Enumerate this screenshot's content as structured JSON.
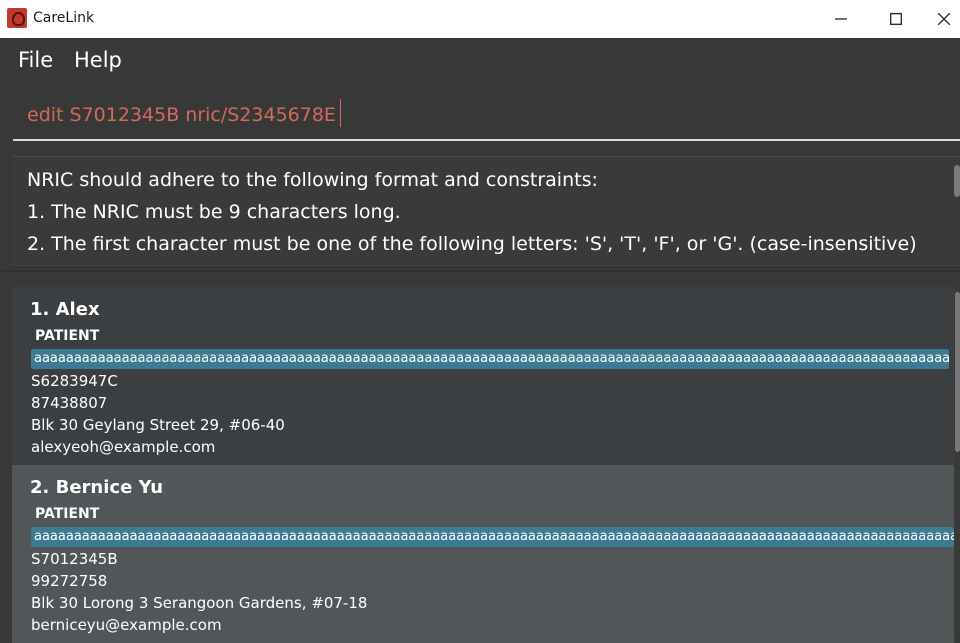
{
  "window": {
    "title": "CareLink"
  },
  "menu": [
    {
      "label": "File"
    },
    {
      "label": "Help"
    }
  ],
  "command": {
    "value": "edit S7012345B nric/S2345678E"
  },
  "result": {
    "lines": [
      "NRIC should adhere to the following format and constraints:",
      "1. The NRIC must be 9 characters long.",
      "2. The first character must be one of the following letters: 'S', 'T', 'F', or 'G'. (case-insensitive)"
    ]
  },
  "persons": [
    {
      "name": "1. Alex",
      "role": "PATIENT",
      "tag": "aaaaaaaaaaaaaaaaaaaaaaaaaaaaaaaaaaaaaaaaaaaaaaaaaaaaaaaaaaaaaaaaaaaaaaaaaaaaaaaaaaaaaaaaaaaaaaaaaaaaaaaaaaaaaaaaaaaaaaa",
      "nric": "S6283947C",
      "phone": "87438807",
      "address": "Blk 30 Geylang Street 29, #06-40",
      "email": "alexyeoh@example.com"
    },
    {
      "name": "2. Bernice Yu",
      "role": "PATIENT",
      "tag": "aaaaaaaaaaaaaaaaaaaaaaaaaaaaaaaaaaaaaaaaaaaaaaaaaaaaaaaaaaaaaaaaaaaaaaaaaaaaaaaaaaaaaaaaaaaaaaaaaaaaaaaaaaaaaaaaaaaaaaaa",
      "nric": "S7012345B",
      "phone": "99272758",
      "address": "Blk 30 Lorong 3 Serangoon Gardens, #07-18",
      "email": "berniceyu@example.com"
    }
  ],
  "colors": {
    "tag": "#3e7b91",
    "command_error_text": "#d06a5c",
    "background": "#383838"
  }
}
